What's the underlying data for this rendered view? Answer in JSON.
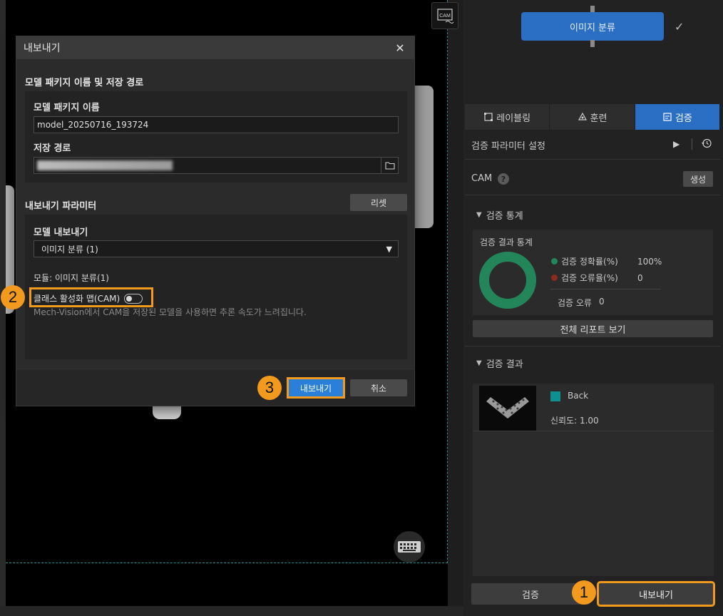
{
  "canvas": {
    "cam_icon_label": "CAM"
  },
  "node": {
    "label": "이미지 분류"
  },
  "tabs": [
    {
      "label": "레이블링"
    },
    {
      "label": "훈련"
    },
    {
      "label": "검증"
    }
  ],
  "validation": {
    "params_label": "검증 파라미터 설정",
    "cam_label": "CAM",
    "help_glyph": "?",
    "generate_label": "생성",
    "stats_section": "검증 통계",
    "stats_title": "검증 결과 통계",
    "accuracy_label": "검증 정확률(%)",
    "accuracy_value": "100%",
    "error_rate_label": "검증 오류율(%)",
    "error_rate_value": "0",
    "errors_label": "검증 오류",
    "errors_value": "0",
    "full_report_label": "전체 리포트 보기",
    "result_section": "검증 결과",
    "result_class": "Back",
    "result_confidence": "신뢰도: 1.00",
    "verify_button": "검증",
    "export_button": "내보내기"
  },
  "dialog": {
    "title": "내보내기",
    "close_glyph": "✕",
    "section_path": "모델 패키지 이름 및 저장 경로",
    "package_name_label": "모델 패키지 이름",
    "package_name_value": "model_20250716_193724",
    "save_path_label": "저장 경로",
    "section_params": "내보내기 파라미터",
    "reset_label": "리셋",
    "model_export_label": "모델 내보내기",
    "model_select_value": "이미지 분류 (1)",
    "module_text": "모듈: 이미지 분류(1)",
    "cam_toggle_label": "클래스 활성화 맵(CAM)",
    "cam_hint": "Mech-Vision에서 CAM을 저장된 모델을 사용하면 추론 속도가 느려집니다.",
    "export_button": "내보내기",
    "cancel_button": "취소"
  },
  "callouts": [
    "1",
    "2",
    "3"
  ],
  "colors": {
    "accent_blue": "#2a6fc4",
    "highlight_orange": "#f29a1e",
    "accuracy_green": "#23855a",
    "error_red": "#8b2a1e",
    "class_teal": "#0f8f8f"
  }
}
